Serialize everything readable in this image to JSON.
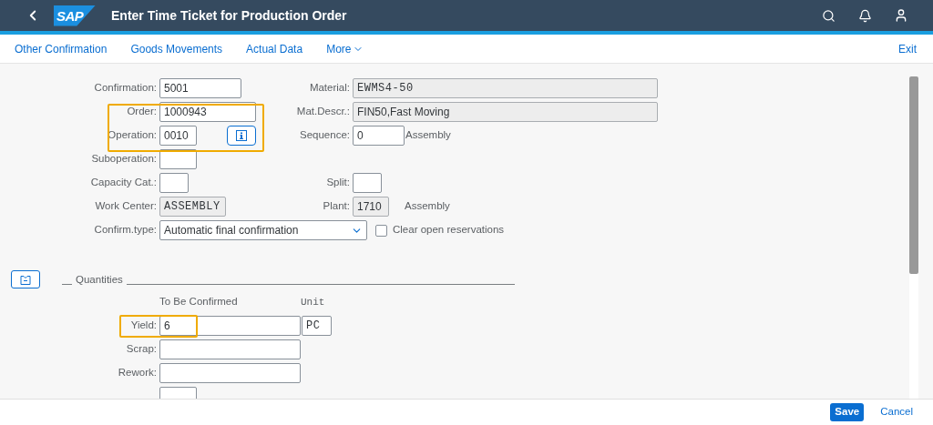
{
  "shell": {
    "logo": "SAP",
    "title": "Enter Time Ticket for Production Order"
  },
  "toolbar": {
    "actions": [
      "Other Confirmation",
      "Goods Movements",
      "Actual Data"
    ],
    "more": "More",
    "exit": "Exit"
  },
  "general": {
    "highlighted": true,
    "confirmation": {
      "label": "Confirmation:",
      "value": "5001",
      "readonly": false
    },
    "order": {
      "label": "Order:",
      "value": "1000943",
      "readonly": false
    },
    "operation": {
      "label": "Operation:",
      "value": "0010",
      "readonly": false
    },
    "suboperation": {
      "label": "Suboperation:",
      "readonly": false
    },
    "capacity_cat": {
      "label": "Capacity Cat.:",
      "readonly": false
    },
    "work_center": {
      "label": "Work Center:",
      "value": "ASSEMBLY",
      "readonly": true
    },
    "confirm_type": {
      "label": "Confirm.type:",
      "value": "Automatic final confirmation"
    },
    "material": {
      "label": "Material:",
      "value": "EWMS4-50",
      "readonly": true
    },
    "mat_descr": {
      "label": "Mat.Descr.:",
      "value": "FIN50,Fast Moving",
      "readonly": true
    },
    "sequence": {
      "label": "Sequence:",
      "value": "0",
      "readonly": false,
      "note": "Assembly"
    },
    "split": {
      "label": "Split:",
      "readonly": false
    },
    "plant": {
      "label": "Plant:",
      "value": "1710",
      "readonly": true,
      "note": "Assembly"
    },
    "clear_reservations": {
      "label": "Clear open reservations",
      "checked": false
    }
  },
  "quantities": {
    "title": "Quantities",
    "column_headers": [
      "To Be Confirmed",
      "Unit"
    ],
    "rows": [
      {
        "kind": "quantity",
        "label": "Yield:",
        "value": "6",
        "unit": "PC",
        "highlighted": true
      },
      {
        "kind": "quantity",
        "label": "Scrap:",
        "highlighted": false
      },
      {
        "kind": "quantity",
        "label": "Rework:",
        "highlighted": false
      },
      {
        "kind": "code",
        "highlighted": false
      }
    ]
  },
  "footer": {
    "buttons": [
      "Save",
      "Cancel"
    ]
  }
}
